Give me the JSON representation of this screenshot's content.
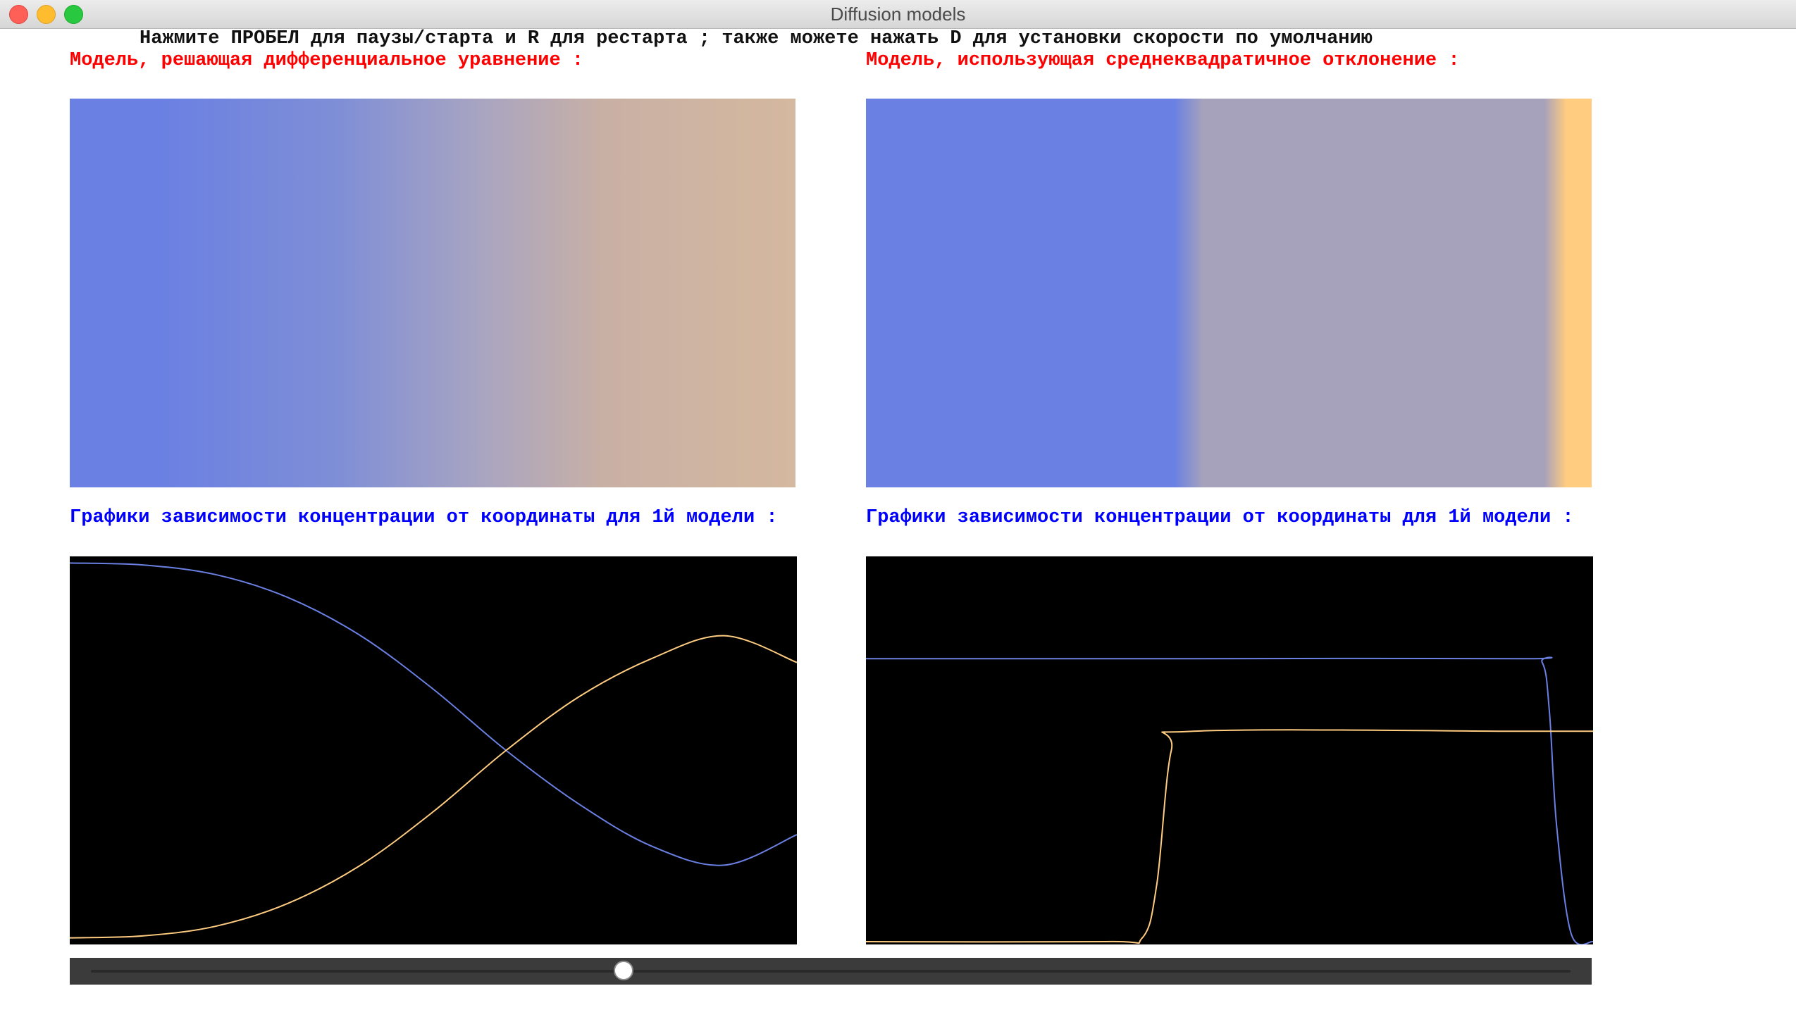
{
  "window": {
    "title": "Diffusion models"
  },
  "instruction": "Нажмите ПРОБЕЛ для паузы/старта и R для рестарта ; также можете нажать D для установки скорости по умолчанию",
  "left_model": {
    "label": "Модель, решающая дифференциальное уравнение :",
    "graph_label": "Графики зависимости концентрации от координаты для 1й модели :"
  },
  "right_model": {
    "label": "Модель, использующая среднеквадратичное отклонение :",
    "graph_label": "Графики зависимости концентрации от координаты для 1й модели :"
  },
  "colors": {
    "label_red": "#ff0000",
    "label_blue": "#0000ff",
    "substance_a": "#6a80e3",
    "substance_b": "#ffcc80",
    "mixed": "#a7a2bc",
    "graph_bg": "#000000"
  },
  "slider": {
    "value": 0.36
  },
  "chart_data": [
    {
      "type": "line",
      "title": "",
      "xlabel": "",
      "ylabel": "",
      "xlim": [
        0,
        1
      ],
      "ylim": [
        0,
        1
      ],
      "grid": false,
      "x": [
        0.0,
        0.1,
        0.2,
        0.3,
        0.4,
        0.5,
        0.6,
        0.7,
        0.8,
        0.9,
        1.0
      ],
      "series": [
        {
          "color": "#6a80e3",
          "values": [
            0.99,
            0.985,
            0.96,
            0.9,
            0.8,
            0.66,
            0.5,
            0.36,
            0.25,
            0.2,
            0.28
          ]
        },
        {
          "color": "#ffcc80",
          "values": [
            0.01,
            0.015,
            0.04,
            0.1,
            0.2,
            0.34,
            0.5,
            0.64,
            0.74,
            0.8,
            0.73
          ]
        }
      ]
    },
    {
      "type": "line",
      "title": "",
      "xlabel": "",
      "ylabel": "",
      "xlim": [
        0,
        1
      ],
      "ylim": [
        0,
        1
      ],
      "grid": false,
      "x": [
        0.0,
        0.33,
        0.38,
        0.4,
        0.42,
        0.45,
        0.9,
        0.93,
        0.94,
        0.95,
        0.97,
        1.0
      ],
      "series": [
        {
          "color": "#6a80e3",
          "values": [
            0.74,
            0.74,
            0.74,
            0.74,
            0.74,
            0.74,
            0.74,
            0.73,
            0.6,
            0.3,
            0.02,
            0.0
          ]
        },
        {
          "color": "#ffcc80",
          "values": [
            0.0,
            0.0,
            0.01,
            0.15,
            0.5,
            0.55,
            0.55,
            0.55,
            0.55,
            0.55,
            0.55,
            0.55
          ]
        }
      ]
    }
  ]
}
